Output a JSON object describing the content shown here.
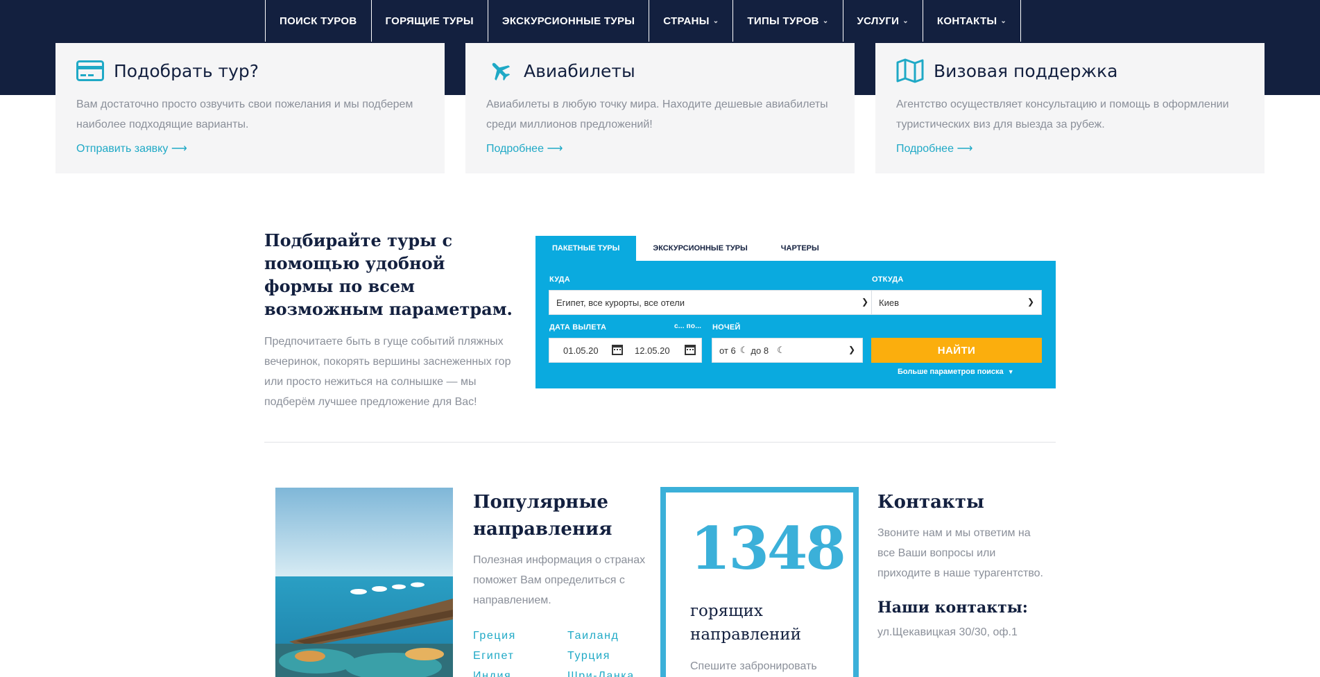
{
  "nav": {
    "items": [
      {
        "label": "ПОИСК ТУРОВ",
        "dropdown": false
      },
      {
        "label": "ГОРЯЩИЕ ТУРЫ",
        "dropdown": false
      },
      {
        "label": "ЭКСКУРСИОННЫЕ ТУРЫ",
        "dropdown": false
      },
      {
        "label": "СТРАНЫ",
        "dropdown": true
      },
      {
        "label": "ТИПЫ ТУРОВ",
        "dropdown": true
      },
      {
        "label": "УСЛУГИ",
        "dropdown": true
      },
      {
        "label": "КОНТАКТЫ",
        "dropdown": true
      }
    ]
  },
  "cards": [
    {
      "icon": "credit-card-icon",
      "title": "Подобрать тур?",
      "text": "Вам достаточно просто озвучить свои пожелания и мы подберем наиболее подходящие варианты.",
      "link": "Отправить заявку"
    },
    {
      "icon": "airplane-icon",
      "title": "Авиабилеты",
      "text": "Авиабилеты в любую точку мира. Находите дешевые авиабилеты среди миллионов предложений!",
      "link": "Подробнее"
    },
    {
      "icon": "map-icon",
      "title": "Визовая поддержка",
      "text": "Агентство осуществляет консультацию и помощь в оформлении туристических виз для выезда за рубеж.",
      "link": "Подробнее"
    }
  ],
  "intro": {
    "title": "Подбирайте туры с помощью удобной формы по всем возможным параметрам.",
    "text": "Предпочитаете быть в гуще событий пляжных вечеринок, покорять вершины заснеженных гор или просто нежиться на солнышке — мы подберём лучшее предложение для Вас!"
  },
  "search": {
    "tabs": [
      "ПАКЕТНЫЕ ТУРЫ",
      "ЭКСКУРСИОННЫЕ ТУРЫ",
      "ЧАРТЕРЫ"
    ],
    "active_tab": 0,
    "where_label": "КУДА",
    "where_value": "Египет, все курорты, все отели",
    "from_label": "ОТКУДА",
    "from_value": "Киев",
    "date_label": "ДАТА ВЫЛЕТА",
    "date_hint": "с... по...",
    "date_from": "01.05.20",
    "date_to": "12.05.20",
    "nights_label": "НОЧЕЙ",
    "nights_from": "от 6",
    "nights_to": "до 8",
    "find_button": "НАЙТИ",
    "more_params": "Больше параметров поиска"
  },
  "popular": {
    "title": "Популярные направления",
    "text": "Полезная информация о странах поможет Вам определиться с направлением.",
    "destinations": [
      "Греция",
      "Таиланд",
      "Египет",
      "Турция",
      "Индия",
      "Шри-Ланка"
    ]
  },
  "hot": {
    "number": "1348",
    "label": "горящих направлений",
    "text": "Спешите забронировать"
  },
  "contacts": {
    "title": "Контакты",
    "text": "Звоните нам и мы ответим на все Ваши вопросы или приходите в наше турагентство.",
    "subtitle": "Наши контакты:",
    "address": "ул.Щекавицкая 30/30, оф.1"
  },
  "colors": {
    "navy": "#13203f",
    "accent": "#0aaadf",
    "teal_text": "#1fa9c6",
    "button": "#fbae0d",
    "card_bg": "#f5f5f6"
  }
}
